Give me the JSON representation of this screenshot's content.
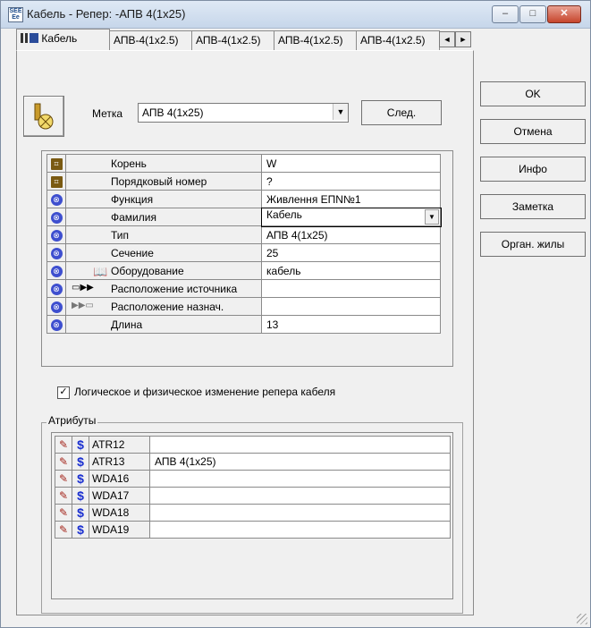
{
  "window": {
    "title": "Кабель - Репер: -АПВ 4(1x25)",
    "icon_text": "SEE Ee",
    "controls": [
      "–",
      "□",
      "✕"
    ]
  },
  "tabs": [
    {
      "label": "Кабель",
      "active": true,
      "icon": "cable-icon"
    },
    {
      "label": "АПВ-4(1x2.5)"
    },
    {
      "label": "АПВ-4(1x2.5)"
    },
    {
      "label": "АПВ-4(1x2.5)"
    },
    {
      "label": "АПВ-4(1x2.5)"
    }
  ],
  "tab_scroll": {
    "left": "◄",
    "right": "►"
  },
  "header": {
    "label_tag": "Метка",
    "tag_value": "АПВ 4(1x25)",
    "next_button": "След."
  },
  "side_buttons": [
    "OK",
    "Отмена",
    "Инфо",
    "Заметка",
    "Орган. жилы"
  ],
  "properties": [
    {
      "name": "Корень",
      "value": "W",
      "icon": "tree-icon"
    },
    {
      "name": "Порядковый номер",
      "value": "?",
      "icon": "tree-icon"
    },
    {
      "name": "Функция",
      "value": "Живлення ЕПN№1",
      "icon": "property-icon"
    },
    {
      "name": "Фамилия",
      "value": "Кабель",
      "icon": "property-icon",
      "dropdown": true
    },
    {
      "name": "Тип",
      "value": "АПВ 4(1x25)",
      "icon": "property-icon"
    },
    {
      "name": "Сечение",
      "value": "25",
      "icon": "property-icon"
    },
    {
      "name": "Оборудование",
      "value": "кабель",
      "icon": "property-icon",
      "sub_icon": "book-icon"
    },
    {
      "name": "Расположение источника",
      "value": "",
      "icon": "property-icon",
      "sub_icon": "source-location-icon"
    },
    {
      "name": "Расположение назнач.",
      "value": "",
      "icon": "property-icon",
      "sub_icon": "destination-location-icon"
    },
    {
      "name": "Длина",
      "value": "13",
      "icon": "property-icon"
    }
  ],
  "checkbox": {
    "checked": true,
    "label": "Логическое и физическое изменение репера кабеля"
  },
  "attributes": {
    "title": "Атрибуты",
    "rows": [
      {
        "name": "ATR12",
        "value": ""
      },
      {
        "name": "ATR13",
        "value": "АПВ 4(1x25)"
      },
      {
        "name": "WDA16",
        "value": ""
      },
      {
        "name": "WDA17",
        "value": ""
      },
      {
        "name": "WDA18",
        "value": ""
      },
      {
        "name": "WDA19",
        "value": ""
      }
    ]
  }
}
